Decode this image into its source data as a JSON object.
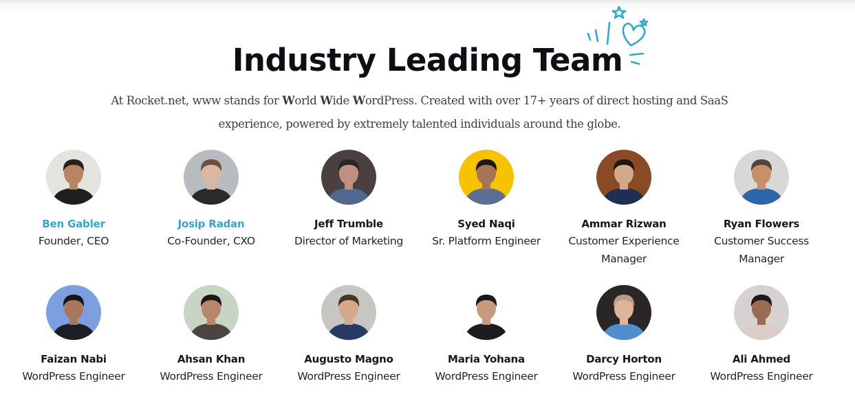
{
  "section": {
    "title": "Industry Leading Team",
    "subtitle_parts": {
      "p1": "At Rocket.net, www stands for ",
      "w1": "W",
      "p2": "orld ",
      "w2": "W",
      "p3": "ide ",
      "w3": "W",
      "p4": "ordPress. Created with over 17+ years of direct hosting and SaaS",
      "p5": "experience, powered by extremely talented individuals around the globe."
    },
    "decoration_icon": "heart-stars-doodle",
    "accent_color": "#2ea8d0"
  },
  "team": [
    {
      "name": "Ben Gabler",
      "role": "Founder, CEO",
      "linked": true,
      "avatar_bg": "#e4e3de",
      "skin": "#b98462",
      "hair": "#2a211d",
      "shirt": "#1e1e1f"
    },
    {
      "name": "Josip Radan",
      "role": "Co-Founder, CXO",
      "linked": true,
      "avatar_bg": "#b8bcc0",
      "skin": "#d9b7a3",
      "hair": "#6b5140",
      "shirt": "#2a2a2c"
    },
    {
      "name": "Jeff Trumble",
      "role": "Director of Marketing",
      "linked": false,
      "avatar_bg": "#4a4040",
      "skin": "#c09080",
      "hair": "#2b2522",
      "shirt": "#51688e"
    },
    {
      "name": "Syed Naqi",
      "role": "Sr. Platform Engineer",
      "linked": false,
      "avatar_bg": "#f7c300",
      "skin": "#a87456",
      "hair": "#1d1612",
      "shirt": "#5b6f94"
    },
    {
      "name": "Ammar Rizwan",
      "role": "Customer Experience Manager",
      "linked": false,
      "avatar_bg": "#8b4a26",
      "skin": "#d2a88a",
      "hair": "#1e1714",
      "shirt": "#1f2e55"
    },
    {
      "name": "Ryan Flowers",
      "role": "Customer Success Manager",
      "linked": false,
      "avatar_bg": "#d8d9d6",
      "skin": "#c98f6a",
      "hair": "#4e4640",
      "shirt": "#2d66a8"
    },
    {
      "name": "Faizan Nabi",
      "role": "WordPress Engineer",
      "linked": false,
      "avatar_bg": "#7c9fdf",
      "skin": "#a8785d",
      "hair": "#1a1514",
      "shirt": "#1e1f24"
    },
    {
      "name": "Ahsan Khan",
      "role": "WordPress Engineer",
      "linked": false,
      "avatar_bg": "#c8d4c4",
      "skin": "#b6876a",
      "hair": "#1c1614",
      "shirt": "#4c4440"
    },
    {
      "name": "Augusto Magno",
      "role": "WordPress Engineer",
      "linked": false,
      "avatar_bg": "#c8c6c2",
      "skin": "#d5a88c",
      "hair": "#4a3426",
      "shirt": "#253a66"
    },
    {
      "name": "Maria Yohana",
      "role": "WordPress Engineer",
      "linked": false,
      "avatar_bg": "#ffffff",
      "skin": "#c79a7c",
      "hair": "#1b1818",
      "shirt": "#1d1d1f"
    },
    {
      "name": "Darcy Horton",
      "role": "WordPress Engineer",
      "linked": false,
      "avatar_bg": "#2a2626",
      "skin": "#e0b39c",
      "hair": "#b69c88",
      "shirt": "#4f8fd0"
    },
    {
      "name": "Ali Ahmed",
      "role": "WordPress Engineer",
      "linked": false,
      "avatar_bg": "#d6d2d2",
      "skin": "#9a6b52",
      "hair": "#1f1816",
      "shirt": "#d9cfc8"
    }
  ]
}
